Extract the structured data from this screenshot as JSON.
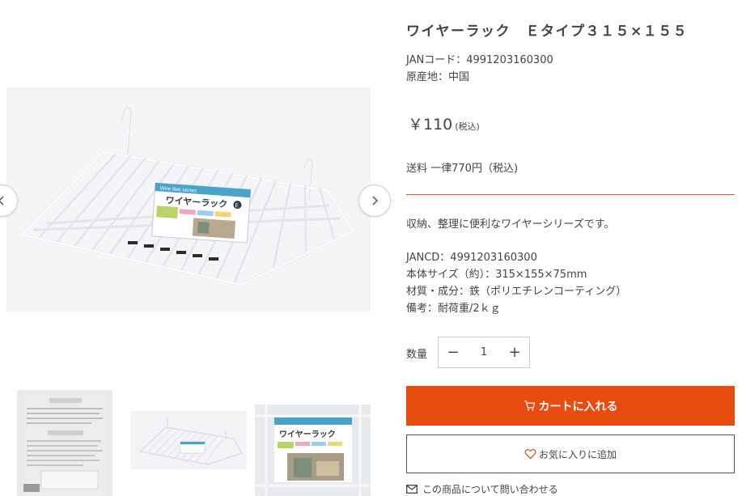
{
  "gallery": {
    "prev_arrow": "‹",
    "next_arrow": "›",
    "main_image_label": "ワイヤーラック",
    "package_header": "Wire Net series",
    "package_badge": "E",
    "thumbnail_label": "ワイヤーラック"
  },
  "product": {
    "title": "ワイヤーラック　Ｅタイプ３１５×１５５",
    "jan_line": "JANコード：4991203160300",
    "origin_line": "原産地：中国",
    "price": "￥110",
    "price_tax": "(税込)",
    "shipping": "送料 一律770円（税込)",
    "description": "収納、整理に便利なワイヤーシリーズです。",
    "specs": [
      "JANCD：4991203160300",
      "本体サイズ（約）：315×155×75mm",
      "材質・成分：鉄（ポリエチレンコーティング）",
      "備考：耐荷重/2ｋｇ"
    ]
  },
  "purchase": {
    "quantity_label": "数量",
    "quantity_value": "1",
    "minus_label": "−",
    "plus_label": "+",
    "add_to_cart_label": "カートに入れる",
    "favorite_label": "お気に入りに追加",
    "contact_label": "この商品について問い合わせる"
  },
  "colors": {
    "accent": "#e84c0e",
    "divider": "#d6582a",
    "text": "#444444"
  },
  "icons": {
    "cart": "cart-icon",
    "heart": "heart-icon",
    "mail": "mail-icon",
    "prev": "chevron-left-icon",
    "next": "chevron-right-icon"
  }
}
